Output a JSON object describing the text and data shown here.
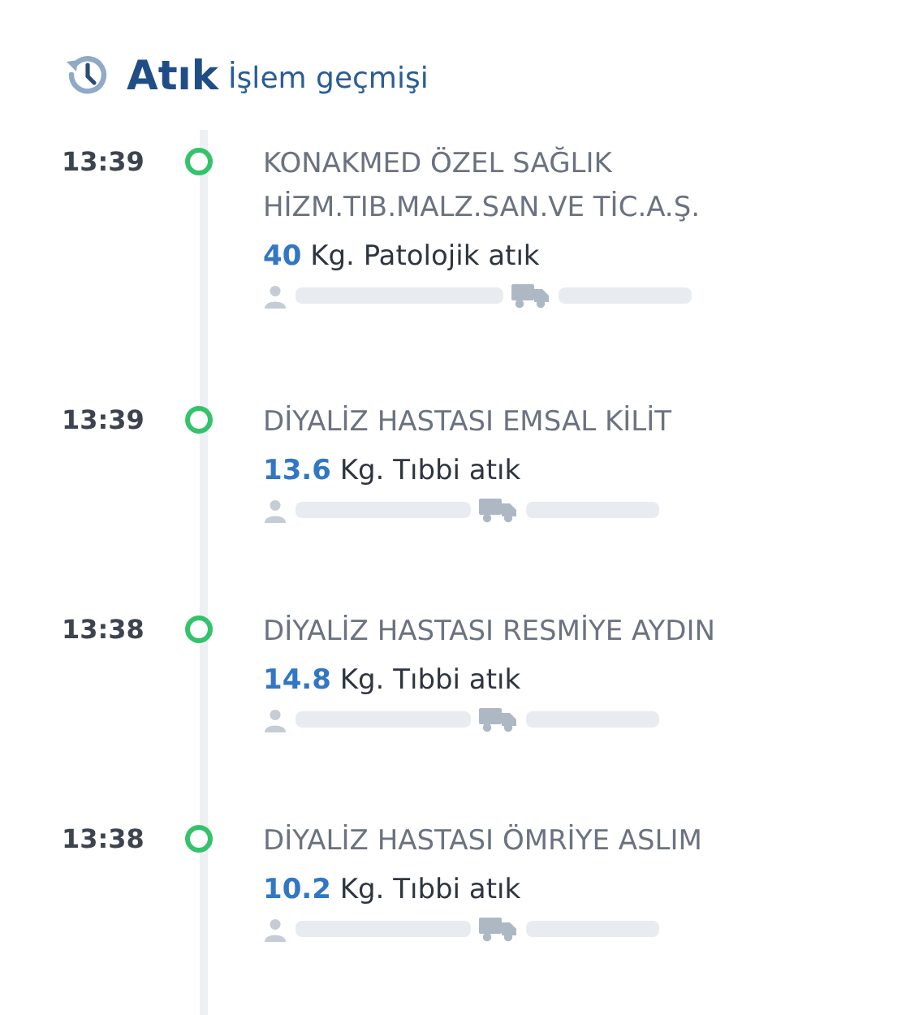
{
  "header": {
    "title": "Atık",
    "subtitle": "İşlem geçmişi"
  },
  "entries": [
    {
      "time": "13:39",
      "name": "KONAKMED ÖZEL SAĞLIK HİZM.TIB.MALZ.SAN.VE TİC.A.Ş.",
      "amount": "40",
      "unit": "Kg. Patolojik atık"
    },
    {
      "time": "13:39",
      "name": "DİYALİZ HASTASI EMSAL KİLİT",
      "amount": "13.6",
      "unit": "Kg. Tıbbi atık"
    },
    {
      "time": "13:38",
      "name": "DİYALİZ HASTASI RESMİYE AYDIN",
      "amount": "14.8",
      "unit": "Kg. Tıbbi atık"
    },
    {
      "time": "13:38",
      "name": "DİYALİZ HASTASI ÖMRİYE ASLIM",
      "amount": "10.2",
      "unit": "Kg. Tıbbi atık"
    }
  ]
}
